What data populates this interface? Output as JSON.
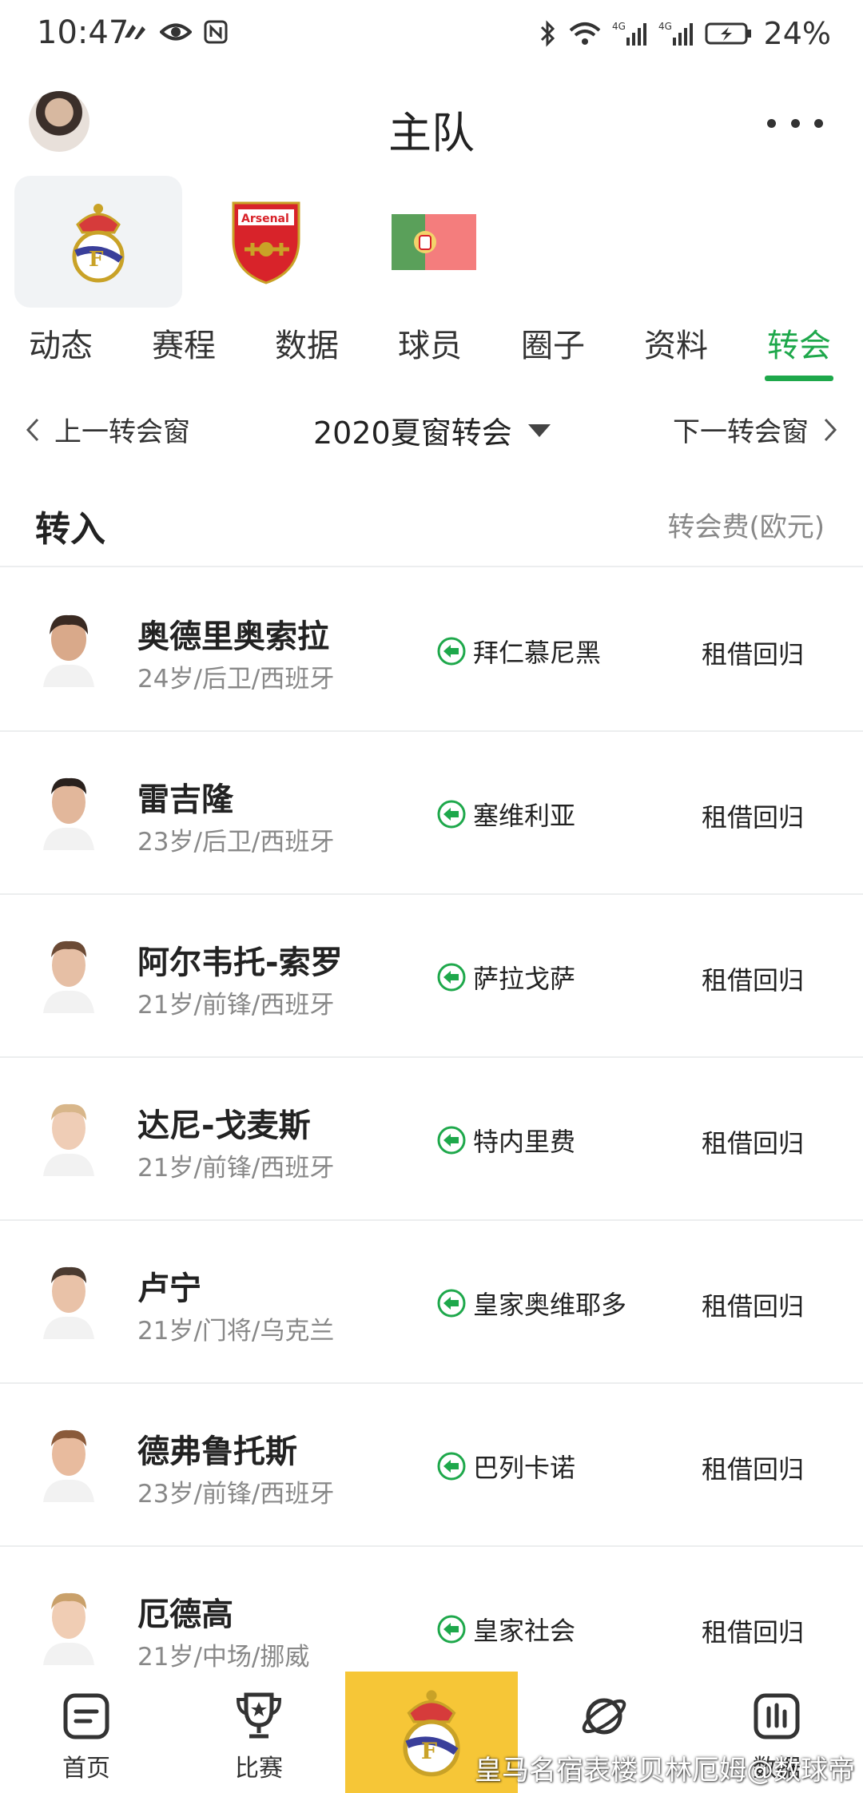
{
  "status_bar": {
    "time": "10:47",
    "battery": "24%",
    "left_icons": [
      "vpn-icon",
      "eye-icon",
      "nfc-icon"
    ],
    "right_icons": [
      "bluetooth-icon",
      "wifi-icon",
      "signal-4g-icon",
      "signal-4g-icon",
      "battery-icon"
    ]
  },
  "header": {
    "title": "主队",
    "avatar": "user-avatar",
    "more_icon": "more-icon"
  },
  "teams": [
    {
      "name": "real-madrid-crest",
      "active": true
    },
    {
      "name": "arsenal-crest",
      "active": false
    },
    {
      "name": "portugal-flag",
      "active": false
    }
  ],
  "tabs": [
    {
      "label": "动态"
    },
    {
      "label": "赛程"
    },
    {
      "label": "数据"
    },
    {
      "label": "球员"
    },
    {
      "label": "圈子"
    },
    {
      "label": "资料"
    },
    {
      "label": "转会",
      "active": true
    }
  ],
  "window_nav": {
    "prev": "上一转会窗",
    "current": "2020夏窗转会",
    "next": "下一转会窗"
  },
  "section": {
    "title": "转入",
    "fee_header": "转会费(欧元)"
  },
  "transfers": [
    {
      "name": "奥德里奥索拉",
      "info": "24岁/后卫/西班牙",
      "from": "拜仁慕尼黑",
      "fee": "租借回归"
    },
    {
      "name": "雷吉隆",
      "info": "23岁/后卫/西班牙",
      "from": "塞维利亚",
      "fee": "租借回归"
    },
    {
      "name": "阿尔韦托-索罗",
      "info": "21岁/前锋/西班牙",
      "from": "萨拉戈萨",
      "fee": "租借回归"
    },
    {
      "name": "达尼-戈麦斯",
      "info": "21岁/前锋/西班牙",
      "from": "特内里费",
      "fee": "租借回归"
    },
    {
      "name": "卢宁",
      "info": "21岁/门将/乌克兰",
      "from": "皇家奥维耶多",
      "fee": "租借回归"
    },
    {
      "name": "德弗鲁托斯",
      "info": "23岁/前锋/西班牙",
      "from": "巴列卡诺",
      "fee": "租借回归"
    },
    {
      "name": "厄德高",
      "info": "21岁/中场/挪威",
      "from": "皇家社会",
      "fee": "租借回归"
    }
  ],
  "bottom_nav": [
    {
      "label": "首页",
      "icon": "home-icon"
    },
    {
      "label": "比赛",
      "icon": "trophy-icon"
    },
    {
      "label": "",
      "icon": "real-madrid-crest"
    },
    {
      "label": "",
      "icon": "planet-icon"
    },
    {
      "label": "数据",
      "icon": "stats-icon"
    }
  ],
  "watermark": "皇马名宿表楼贝林厄姆@数球帝",
  "colors": {
    "accent_green": "#1ea84b",
    "center_nav_yellow": "#f6c637",
    "muted_text": "#888888"
  }
}
